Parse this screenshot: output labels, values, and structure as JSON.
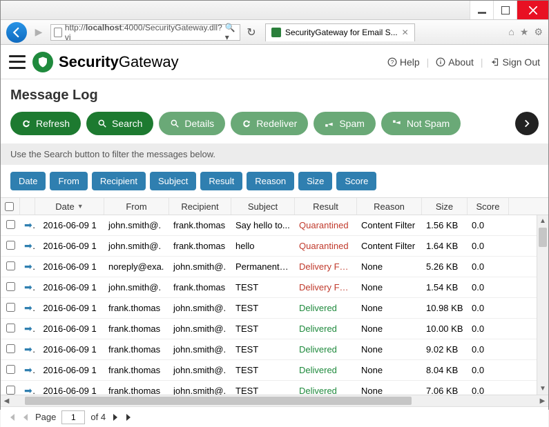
{
  "browser": {
    "url_display": "http://localhost:4000/SecurityGateway.dll?vi",
    "url_host": "localhost",
    "url_port": "4000",
    "url_path": "/SecurityGateway.dll?vi",
    "tab_title": "SecurityGateway for Email S..."
  },
  "header": {
    "logo_bold": "Security",
    "logo_rest": "Gateway",
    "help": "Help",
    "about": "About",
    "signout": "Sign Out"
  },
  "page_title": "Message Log",
  "toolbar": {
    "refresh": "Refresh",
    "search": "Search",
    "details": "Details",
    "redeliver": "Redeliver",
    "spam": "Spam",
    "not_spam": "Not Spam"
  },
  "hint": "Use the Search button to filter the messages below.",
  "filters": {
    "date": "Date",
    "from": "From",
    "recipient": "Recipient",
    "subject": "Subject",
    "result": "Result",
    "reason": "Reason",
    "size": "Size",
    "score": "Score"
  },
  "columns": {
    "date": "Date",
    "from": "From",
    "recipient": "Recipient",
    "subject": "Subject",
    "result": "Result",
    "reason": "Reason",
    "size": "Size",
    "score": "Score"
  },
  "rows": [
    {
      "date": "2016-06-09 1",
      "from": "john.smith@.",
      "rcpt": "frank.thomas",
      "subj": "Say hello to...",
      "result": "Quarantined",
      "result_cls": "res-q",
      "reason": "Content Filter",
      "size": "1.56 KB",
      "score": "0.0"
    },
    {
      "date": "2016-06-09 1",
      "from": "john.smith@.",
      "rcpt": "frank.thomas",
      "subj": "hello",
      "result": "Quarantined",
      "result_cls": "res-q",
      "reason": "Content Filter",
      "size": "1.64 KB",
      "score": "0.0"
    },
    {
      "date": "2016-06-09 1",
      "from": "noreply@exa.",
      "rcpt": "john.smith@.",
      "subj": "Permanent D.",
      "result": "Delivery Fail..",
      "result_cls": "res-f",
      "reason": "None",
      "size": "5.26 KB",
      "score": "0.0"
    },
    {
      "date": "2016-06-09 1",
      "from": "john.smith@.",
      "rcpt": "frank.thomas",
      "subj": "TEST",
      "result": "Delivery Fail..",
      "result_cls": "res-f",
      "reason": "None",
      "size": "1.54 KB",
      "score": "0.0"
    },
    {
      "date": "2016-06-09 1",
      "from": "frank.thomas",
      "rcpt": "john.smith@.",
      "subj": "TEST",
      "result": "Delivered",
      "result_cls": "res-d",
      "reason": "None",
      "size": "10.98 KB",
      "score": "0.0"
    },
    {
      "date": "2016-06-09 1",
      "from": "frank.thomas",
      "rcpt": "john.smith@.",
      "subj": "TEST",
      "result": "Delivered",
      "result_cls": "res-d",
      "reason": "None",
      "size": "10.00 KB",
      "score": "0.0"
    },
    {
      "date": "2016-06-09 1",
      "from": "frank.thomas",
      "rcpt": "john.smith@.",
      "subj": "TEST",
      "result": "Delivered",
      "result_cls": "res-d",
      "reason": "None",
      "size": "9.02 KB",
      "score": "0.0"
    },
    {
      "date": "2016-06-09 1",
      "from": "frank.thomas",
      "rcpt": "john.smith@.",
      "subj": "TEST",
      "result": "Delivered",
      "result_cls": "res-d",
      "reason": "None",
      "size": "8.04 KB",
      "score": "0.0"
    },
    {
      "date": "2016-06-09 1",
      "from": "frank.thomas",
      "rcpt": "john.smith@.",
      "subj": "TEST",
      "result": "Delivered",
      "result_cls": "res-d",
      "reason": "None",
      "size": "7.06 KB",
      "score": "0.0"
    }
  ],
  "pager": {
    "label_page": "Page",
    "current": "1",
    "of_label": "of 4"
  }
}
